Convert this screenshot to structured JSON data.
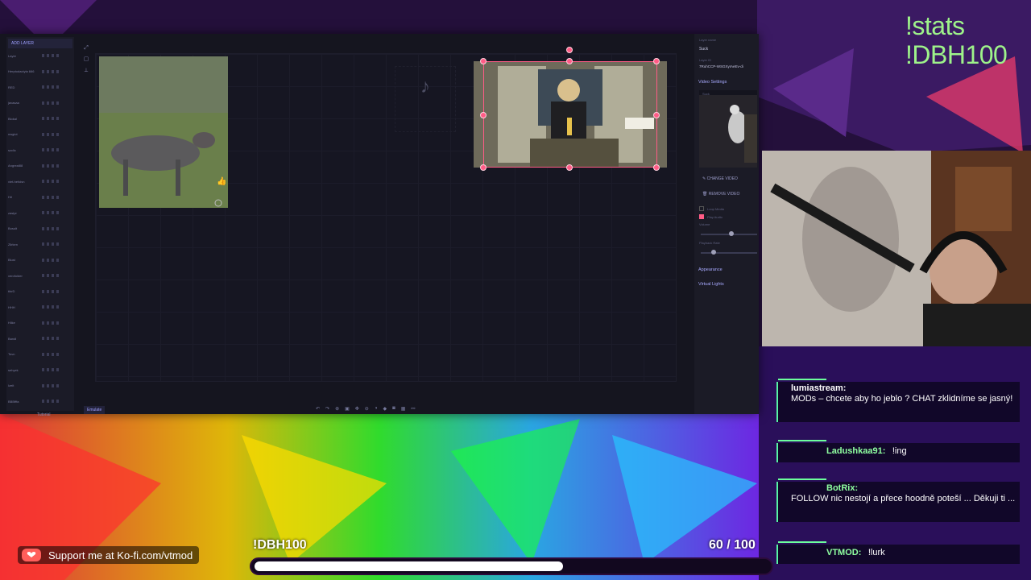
{
  "app": {
    "sidebar": {
      "add_layer_label": "ADD LAYER",
      "items": [
        "Layer",
        "Herptodactyla 666",
        "RED",
        "javasaa",
        "Blokal",
        "nwgiot",
        "szclic",
        "Angreal88",
        "viet-hefoisn",
        "Hrl",
        "zastpr",
        "Bosolt",
        "Zlirken",
        "Blust",
        "verofolder",
        "thirD",
        "HHH",
        "Hlike",
        "Bandl",
        "Tovn",
        "sehyek",
        "Izeit",
        "BBBfffa"
      ],
      "tutorial_label": "Tutorial"
    },
    "toolbar_bottom": {
      "emulate_label": "Emulate"
    },
    "panel": {
      "layer_name_label": "Layer name",
      "layer_name_value": "Suck",
      "layer_id_label": "Layer ID",
      "layer_id_value": "7RuhCCP-WSGXyIAeEv-di",
      "video_settings_label": "Video Settings",
      "preview_label": "Suck",
      "change_video_label": "CHANGE VIDEO",
      "remove_video_label": "REMOVE VIDEO",
      "loop_media_label": "Loop Media",
      "play_audio_label": "Play Audio",
      "volume_label": "Volume",
      "volume_value": 0.55,
      "playback_rate_label": "Playback Rate",
      "playback_rate_value": 0.2,
      "appearance_label": "Appearance",
      "virtual_lights_label": "Virtual Lights"
    }
  },
  "overlay": {
    "stats_line1": "!stats",
    "stats_line2": "!DBH100",
    "goal_label": "!DBH100",
    "goal_progress": "60",
    "goal_separator": "/",
    "goal_total": "100",
    "goal_fraction": 0.6,
    "kofi_text": "Support me at Ko-fi.com/vtmod",
    "colors": {
      "accent": "#9ef38a",
      "handle": "#ff5c86"
    }
  },
  "chat": [
    {
      "user": "lumiastream:",
      "text": "MODs – chcete aby ho jeblo ? CHAT zklidníme se jasný!",
      "color": "#c7f7ff"
    },
    {
      "user": "Ladushkaa91:",
      "text": "!ing",
      "color": "#8fffa0"
    },
    {
      "user": "BotRix:",
      "text": "FOLLOW nic nestojí a přece hoodně poteší ... Děkuji ti ...",
      "color": "#8fffa0"
    },
    {
      "user": "VTMOD:",
      "text": "!lurk",
      "color": "#8fffa0"
    }
  ]
}
